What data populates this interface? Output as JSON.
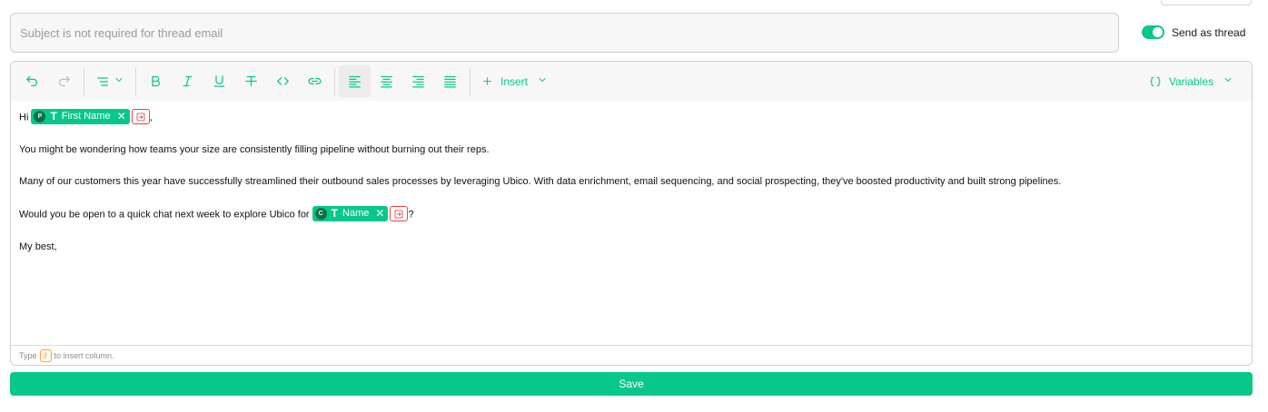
{
  "subject": {
    "placeholder": "Subject is not required for thread email",
    "value": ""
  },
  "thread_toggle": {
    "label": "Send as thread",
    "on": true
  },
  "toolbar": {
    "insert_label": "Insert",
    "variables_label": "Variables"
  },
  "body": {
    "greeting_prefix": "Hi",
    "greeting_pill": {
      "badge": "P",
      "label": "First Name"
    },
    "greeting_suffix": ",",
    "line1": "You might be wondering how teams your size are consistently filling pipeline without burning out their reps.",
    "line2": "Many of our customers this year have successfully streamlined their outbound sales processes by leveraging Ubico. With data enrichment, email sequencing, and social prospecting, they've boosted productivity and built strong pipelines.",
    "line3_prefix": "Would you be open to a quick chat next week to explore Ubico for",
    "line3_pill": {
      "badge": "C",
      "label": "Name"
    },
    "line3_suffix": "?",
    "signoff": "My best,"
  },
  "hint": {
    "prefix": "Type",
    "key": "/",
    "suffix": "to insert column."
  },
  "save_label": "Save",
  "colors": {
    "accent": "#07c88a",
    "flag": "#e04848"
  }
}
